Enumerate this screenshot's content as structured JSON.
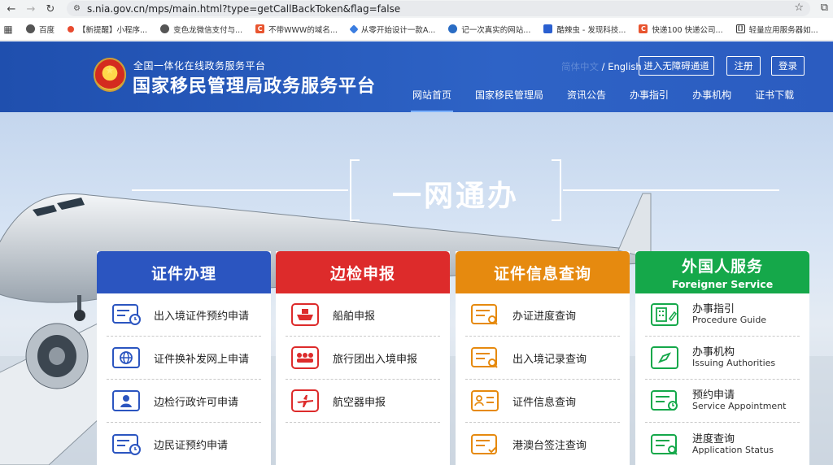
{
  "browser": {
    "url": "s.nia.gov.cn/mps/main.html?type=getCallBackToken&flag=false",
    "bookmarks": [
      {
        "label": "百度",
        "color": "#555555"
      },
      {
        "label": "【新提醒】小程序...",
        "color": "#e84a2f"
      },
      {
        "label": "变色龙微信支付与...",
        "color": "#555555"
      },
      {
        "label": "不带WWW的域名...",
        "color": "#e8542f"
      },
      {
        "label": "从零开始设计一款A...",
        "color": "#3b7de0"
      },
      {
        "label": "记一次真实的网站...",
        "color": "#2a6cc4"
      },
      {
        "label": "酷辣虫 - 发现科技...",
        "color": "#2a5fd0"
      },
      {
        "label": "快递100 快递公司...",
        "color": "#e8542f"
      },
      {
        "label": "轻量应用服务器如...",
        "color": "#333333"
      }
    ]
  },
  "header": {
    "sub_title": "全国一体化在线政务服务平台",
    "main_title": "国家移民管理局政务服务平台",
    "lang_cn": "简体中文",
    "lang_sep": " / ",
    "lang_en": "English",
    "accessible_label": "进入无障碍通道",
    "register_label": "注册",
    "login_label": "登录",
    "nav": [
      "网站首页",
      "国家移民管理局",
      "资讯公告",
      "办事指引",
      "办事机构",
      "证书下载"
    ]
  },
  "hero": {
    "title": "一网通办"
  },
  "cards": [
    {
      "title": "证件办理",
      "items": [
        "出入境证件预约申请",
        "证件换补发网上申请",
        "边检行政许可申请",
        "边民证预约申请"
      ]
    },
    {
      "title": "边检申报",
      "items": [
        "船舶申报",
        "旅行团出入境申报",
        "航空器申报"
      ]
    },
    {
      "title": "证件信息查询",
      "items": [
        "办证进度查询",
        "出入境记录查询",
        "证件信息查询",
        "港澳台签注查询"
      ]
    },
    {
      "title": "外国人服务",
      "subtitle": "Foreigner Service",
      "items": [
        {
          "cn": "办事指引",
          "en": "Procedure Guide"
        },
        {
          "cn": "办事机构",
          "en": "Issuing Authorities"
        },
        {
          "cn": "预约申请",
          "en": "Service Appointment"
        },
        {
          "cn": "进度查询",
          "en": "Application Status"
        }
      ]
    }
  ],
  "colors": {
    "header_blue": "#2b5cc0",
    "card_blue": "#2b55c0",
    "card_red": "#dd2b2b",
    "card_orange": "#e68a0f",
    "card_green": "#15a84a"
  }
}
